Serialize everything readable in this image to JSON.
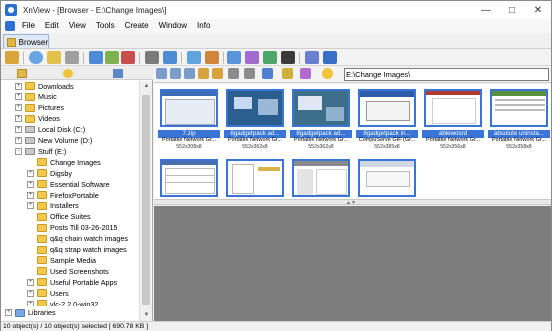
{
  "window": {
    "title": "XnView - [Browser - E:\\Change Images\\]"
  },
  "menu": [
    "File",
    "Edit",
    "View",
    "Tools",
    "Create",
    "Window",
    "Info"
  ],
  "toolbar": {
    "tab_label": "Browser"
  },
  "address": {
    "value": "E:\\Change Images\\"
  },
  "tree": [
    {
      "label": "Downloads",
      "indent": 1,
      "type": "folder",
      "expander": "+"
    },
    {
      "label": "Music",
      "indent": 1,
      "type": "folder",
      "expander": "+"
    },
    {
      "label": "Pictures",
      "indent": 1,
      "type": "folder",
      "expander": "+"
    },
    {
      "label": "Videos",
      "indent": 1,
      "type": "folder",
      "expander": "+"
    },
    {
      "label": "Local Disk (C:)",
      "indent": 1,
      "type": "drive",
      "expander": "+"
    },
    {
      "label": "New Volume (D:)",
      "indent": 1,
      "type": "drive",
      "expander": "+"
    },
    {
      "label": "Stuff (E:)",
      "indent": 1,
      "type": "drive",
      "expander": "-"
    },
    {
      "label": "Change Images",
      "indent": 2,
      "type": "folder",
      "expander": "",
      "selected": true
    },
    {
      "label": "Digsby",
      "indent": 2,
      "type": "folder",
      "expander": "+"
    },
    {
      "label": "Essential Software",
      "indent": 2,
      "type": "folder",
      "expander": "+"
    },
    {
      "label": "FirefoxPortable",
      "indent": 2,
      "type": "folder",
      "expander": "+"
    },
    {
      "label": "Installers",
      "indent": 2,
      "type": "folder",
      "expander": "+"
    },
    {
      "label": "Office Suites",
      "indent": 2,
      "type": "folder",
      "expander": ""
    },
    {
      "label": "Posts Till 03-26-2015",
      "indent": 2,
      "type": "folder",
      "expander": ""
    },
    {
      "label": "q&q chain watch images",
      "indent": 2,
      "type": "folder",
      "expander": ""
    },
    {
      "label": "q&q strap watch images",
      "indent": 2,
      "type": "folder",
      "expander": ""
    },
    {
      "label": "Sample Media",
      "indent": 2,
      "type": "folder",
      "expander": ""
    },
    {
      "label": "Used Screenshots",
      "indent": 2,
      "type": "folder",
      "expander": ""
    },
    {
      "label": "Useful Portable Apps",
      "indent": 2,
      "type": "folder",
      "expander": "+"
    },
    {
      "label": "Users",
      "indent": 2,
      "type": "folder",
      "expander": "+"
    },
    {
      "label": "vlc-2.2.0-win32",
      "indent": 2,
      "type": "folder",
      "expander": "+"
    }
  ],
  "libraries_label": "Libraries",
  "thumbnails": [
    {
      "name": "7.zip",
      "type": "Portable Network Gr...",
      "dims": "552x308x8",
      "selected": true,
      "kind": "app"
    },
    {
      "name": "8gadgetpack ad...",
      "type": "Portable Network Gr...",
      "dims": "552x362x8",
      "selected": true,
      "kind": "desktop"
    },
    {
      "name": "8gadgetpack ad...",
      "type": "Portable Network Gr...",
      "dims": "552x362x8",
      "selected": true,
      "kind": "desktop2"
    },
    {
      "name": "8gadgetpack in...",
      "type": "CompuServe GIF (Gr...",
      "dims": "552x385x8",
      "selected": true,
      "kind": "dialog"
    },
    {
      "name": "ablewosrd",
      "type": "Portable Network Gr...",
      "dims": "552x356x8",
      "selected": true,
      "kind": "doc"
    },
    {
      "name": "absolute uninsta...",
      "type": "Portable Network Gr...",
      "dims": "552x358x8",
      "selected": true,
      "kind": "list"
    },
    {
      "name": "",
      "type": "",
      "dims": "",
      "selected": true,
      "kind": "table"
    },
    {
      "name": "",
      "type": "",
      "dims": "",
      "selected": true,
      "kind": "doc2"
    },
    {
      "name": "",
      "type": "",
      "dims": "",
      "selected": true,
      "kind": "app2"
    },
    {
      "name": "",
      "type": "",
      "dims": "",
      "selected": true,
      "kind": "browser"
    }
  ],
  "status": "10 object(s) / 10 object(s) selected  [ 690.78 KB ]",
  "colors": {
    "selection": "#3875d7",
    "preview_bg": "#7d7d7d",
    "folder": "#f2c94c"
  }
}
